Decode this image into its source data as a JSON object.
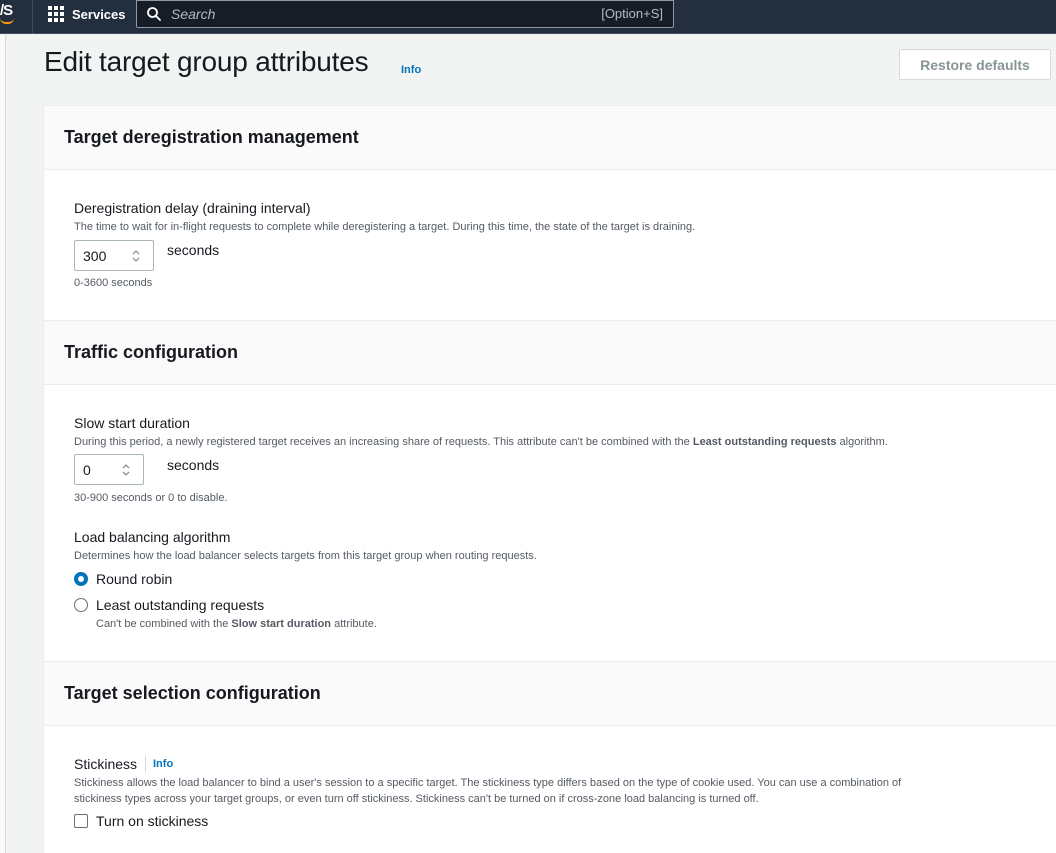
{
  "nav": {
    "logo_text": "/S",
    "services_label": "Services",
    "search_placeholder": "Search",
    "search_shortcut": "[Option+S]"
  },
  "header": {
    "title": "Edit target group attributes",
    "info_link": "Info",
    "restore_button": "Restore defaults"
  },
  "deregistration": {
    "section_title": "Target deregistration management",
    "label": "Deregistration delay (draining interval)",
    "description": "The time to wait for in-flight requests to complete while deregistering a target. During this time, the state of the target is draining.",
    "value": "300",
    "unit": "seconds",
    "constraint": "0-3600 seconds"
  },
  "traffic": {
    "section_title": "Traffic configuration",
    "slow_start": {
      "label": "Slow start duration",
      "description_before": "During this period, a newly registered target receives an increasing share of requests. This attribute can't be combined with the ",
      "description_bold": "Least outstanding requests",
      "description_after": " algorithm.",
      "value": "0",
      "unit": "seconds",
      "constraint": "30-900 seconds or 0 to disable."
    },
    "algorithm": {
      "label": "Load balancing algorithm",
      "description": "Determines how the load balancer selects targets from this target group when routing requests.",
      "options": [
        {
          "label": "Round robin",
          "selected": true
        },
        {
          "label": "Least outstanding requests",
          "selected": false
        }
      ],
      "lor_note_before": "Can't be combined with the ",
      "lor_note_bold": "Slow start duration",
      "lor_note_after": " attribute."
    }
  },
  "target_selection": {
    "section_title": "Target selection configuration",
    "stickiness": {
      "label": "Stickiness",
      "info_link": "Info",
      "description_line1": "Stickiness allows the load balancer to bind a user's session to a specific target. The stickiness type differs based on the type of cookie used. You can use a combination of",
      "description_line2": "stickiness types across your target groups, or even turn off stickiness. Stickiness can't be turned on if cross-zone load balancing is turned off.",
      "checkbox_label": "Turn on stickiness",
      "checked": false
    }
  },
  "colors": {
    "nav_bg": "#232f3e",
    "link": "#0073bb",
    "radio_selected": "#0073bb"
  }
}
